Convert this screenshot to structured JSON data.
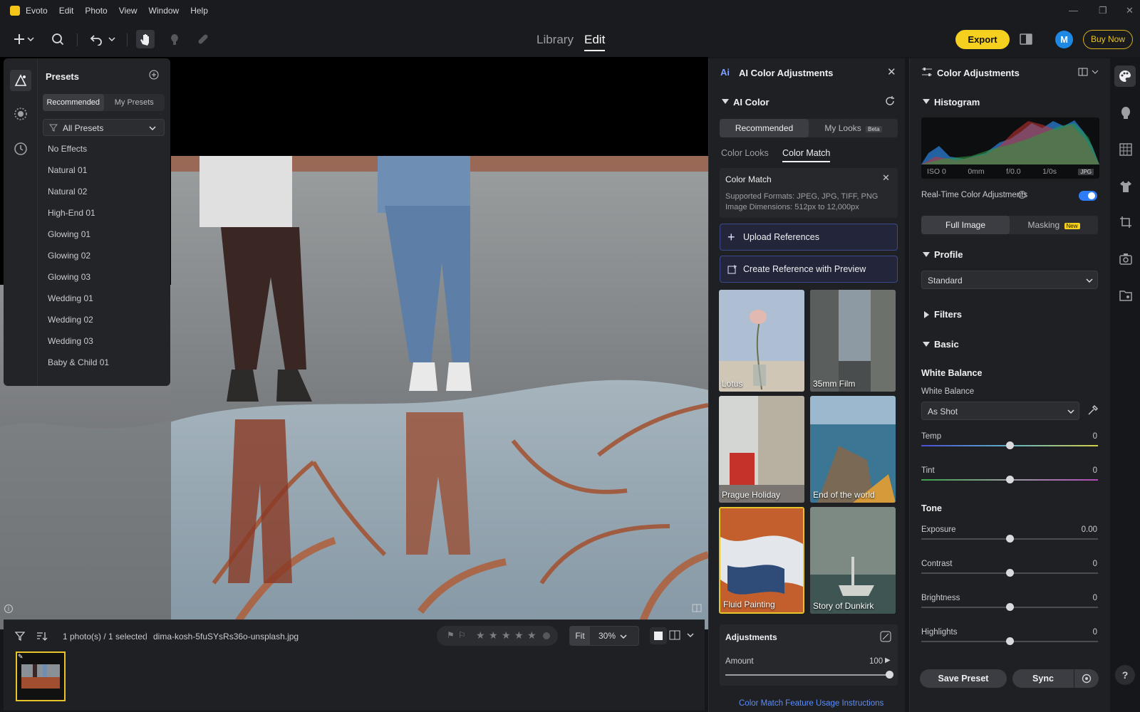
{
  "menubar": {
    "app_name": "Evoto",
    "items": [
      "Edit",
      "Photo",
      "View",
      "Window",
      "Help"
    ]
  },
  "toolbar": {
    "tabs": {
      "library": "Library",
      "edit": "Edit"
    },
    "export_label": "Export",
    "avatar_initial": "M",
    "buy_now_label": "Buy Now"
  },
  "presets_panel": {
    "title": "Presets",
    "tabs": [
      "Recommended",
      "My Presets"
    ],
    "filter_value": "All Presets",
    "items": [
      "No Effects",
      "Natural 01",
      "Natural 02",
      "High-End 01",
      "Glowing 01",
      "Glowing 02",
      "Glowing 03",
      "Wedding 01",
      "Wedding 02",
      "Wedding 03",
      "Baby & Child 01"
    ]
  },
  "ai_panel": {
    "title": "AI Color Adjustments",
    "section_title": "AI Color",
    "seg_tabs": [
      "Recommended",
      "My Looks"
    ],
    "beta_badge": "Beta",
    "subtabs": [
      "Color Looks",
      "Color Match"
    ],
    "info": {
      "title": "Color Match",
      "line1": "Supported Formats: JPEG, JPG, TIFF, PNG",
      "line2": "Image Dimensions: 512px to 12,000px"
    },
    "upload_label": "Upload References",
    "create_ref_label": "Create Reference with Preview",
    "thumbs": [
      "Lotus",
      "35mm Film",
      "Prague Holiday",
      "End of the world",
      "Fluid Painting",
      "Story of Dunkirk"
    ],
    "adjustments": {
      "title": "Adjustments",
      "amount_label": "Amount",
      "amount_value": "100",
      "amount_fraction": 1.0
    },
    "instructions_link": "Color Match Feature Usage Instructions"
  },
  "right_panel": {
    "title": "Color Adjustments",
    "histogram": {
      "title": "Histogram",
      "iso": "ISO 0",
      "focal": "0mm",
      "aperture": "f/0.0",
      "shutter": "1/0s",
      "format": "JPG"
    },
    "realtime_label": "Real-Time Color Adjustments",
    "realtime_on": true,
    "seg_tabs": [
      "Full Image",
      "Masking"
    ],
    "new_badge": "New",
    "profile": {
      "title": "Profile",
      "value": "Standard"
    },
    "filters_title": "Filters",
    "basic_title": "Basic",
    "white_balance_heading": "White Balance",
    "white_balance_label": "White Balance",
    "white_balance_value": "As Shot",
    "sliders_wb": [
      {
        "label": "Temp",
        "value": "0",
        "fraction": 0.5
      },
      {
        "label": "Tint",
        "value": "0",
        "fraction": 0.5
      }
    ],
    "tone_heading": "Tone",
    "sliders_tone": [
      {
        "label": "Exposure",
        "value": "0.00",
        "fraction": 0.5
      },
      {
        "label": "Contrast",
        "value": "0",
        "fraction": 0.5
      },
      {
        "label": "Brightness",
        "value": "0",
        "fraction": 0.5
      },
      {
        "label": "Highlights",
        "value": "0",
        "fraction": 0.5
      }
    ],
    "save_preset_label": "Save Preset",
    "sync_label": "Sync"
  },
  "bottom_bar": {
    "selection_info": "1 photo(s) / 1 selected",
    "filename": "dima-kosh-5fuSYsRs36o-unsplash.jpg",
    "fit_label": "Fit",
    "zoom_value": "30%"
  },
  "colors": {
    "accent_yellow": "#f6d01e",
    "accent_blue": "#1e88e5",
    "panel": "#1e2024"
  }
}
